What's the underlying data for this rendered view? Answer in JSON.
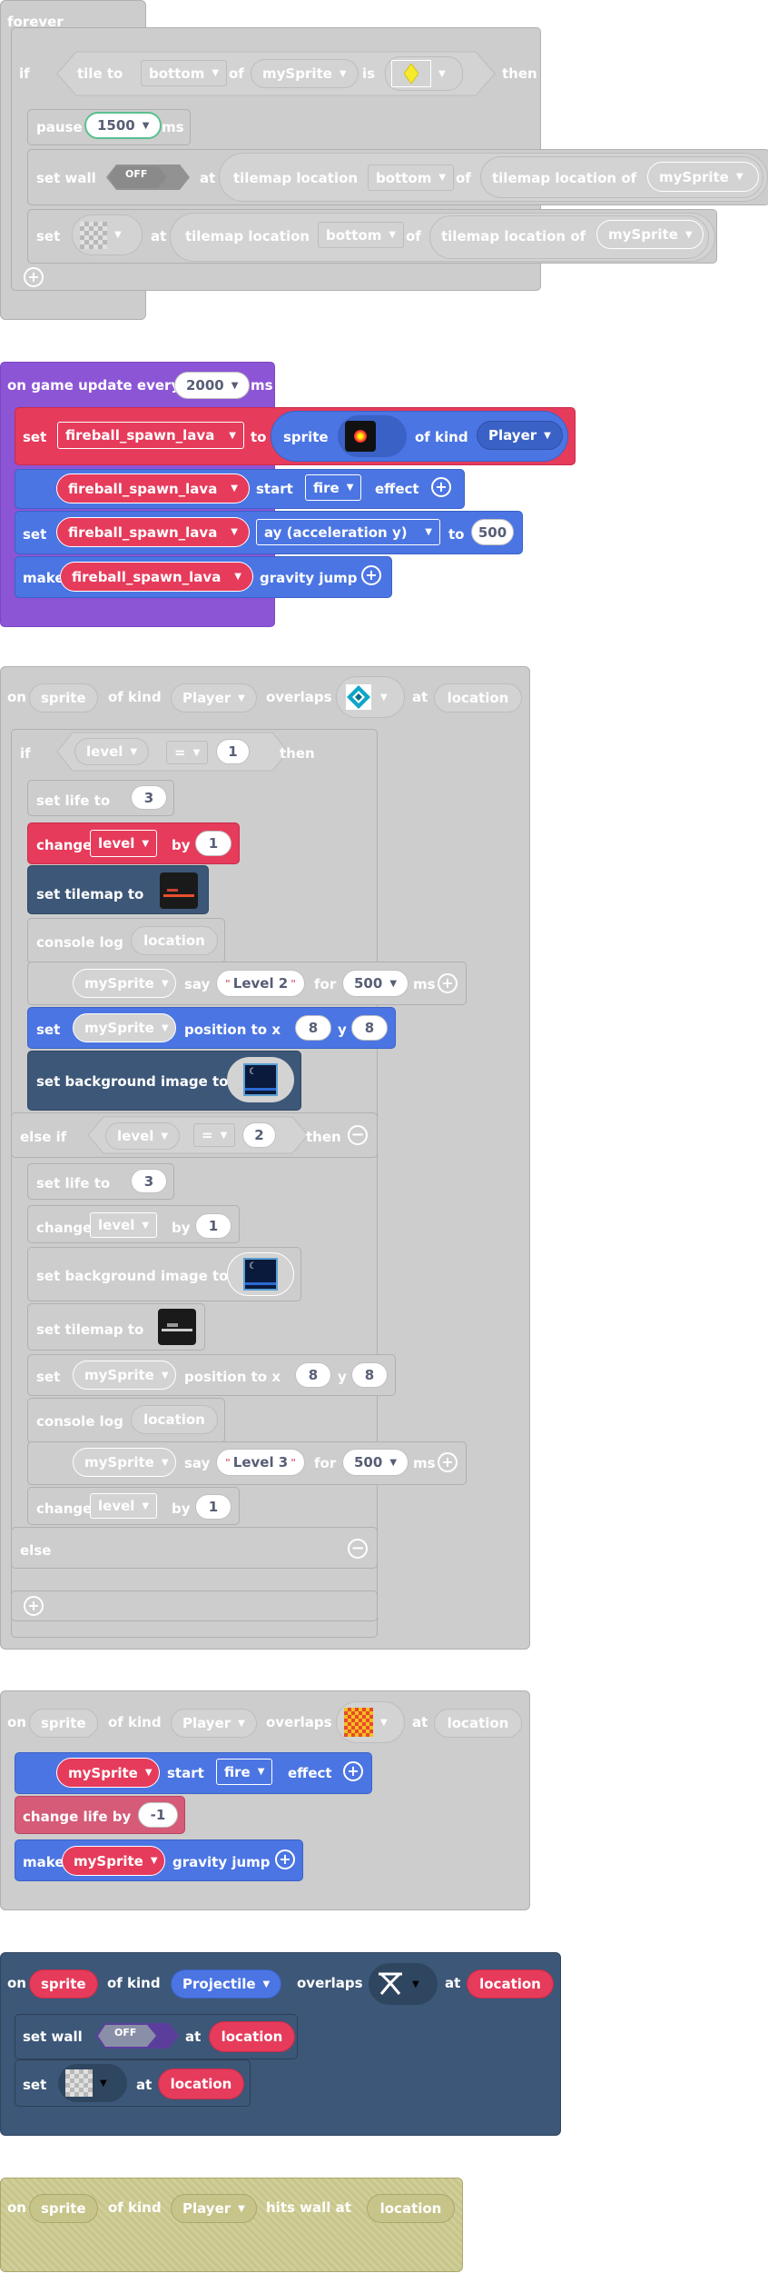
{
  "forever": {
    "hat": "forever",
    "if_label": "if",
    "tile_to": "tile to",
    "bottom": "bottom",
    "of": "of",
    "mySprite": "mySprite",
    "is": "is",
    "then": "then",
    "pause": "pause",
    "pause_value": "1500",
    "ms": "ms",
    "set_wall": "set wall",
    "off": "OFF",
    "at": "at",
    "tilemap_location": "tilemap location",
    "tilemap_location_of": "tilemap location of",
    "set": "set"
  },
  "game_update": {
    "hat": "on game update every",
    "interval": "2000",
    "ms": "ms",
    "set": "set",
    "var": "fireball_spawn_lava",
    "to": "to",
    "sprite": "sprite",
    "of_kind": "of kind",
    "kind": "Player",
    "start": "start",
    "effect_name": "fire",
    "effect": "effect",
    "ay": "ay (acceleration y)",
    "ay_value": "500",
    "make": "make",
    "gravity_jump": "gravity jump"
  },
  "overlap1": {
    "on": "on",
    "sprite": "sprite",
    "of_kind": "of kind",
    "kind": "Player",
    "overlaps": "overlaps",
    "at": "at",
    "location": "location",
    "if_label": "if",
    "level": "level",
    "eq": "=",
    "one": "1",
    "two": "2",
    "then": "then",
    "set_life_to": "set life to",
    "life": "3",
    "change": "change",
    "by": "by",
    "set_tilemap_to": "set tilemap to",
    "console_log": "console log",
    "mySprite": "mySprite",
    "say": "say",
    "say1": "Level 2",
    "say2": "Level 3",
    "for": "for",
    "dur": "500",
    "ms": "ms",
    "set": "set",
    "position_to_x": "position to x",
    "x": "8",
    "y_label": "y",
    "y": "8",
    "set_bg": "set background image to",
    "else_if": "else if",
    "else": "else"
  },
  "overlap2": {
    "on": "on",
    "sprite": "sprite",
    "of_kind": "of kind",
    "kind": "Player",
    "overlaps": "overlaps",
    "at": "at",
    "location": "location",
    "mySprite": "mySprite",
    "start": "start",
    "effect_name": "fire",
    "effect": "effect",
    "change_life_by": "change life by",
    "life_delta": "-1",
    "make": "make",
    "gravity_jump": "gravity jump"
  },
  "overlap3": {
    "on": "on",
    "sprite": "sprite",
    "of_kind": "of kind",
    "kind": "Projectile",
    "overlaps": "overlaps",
    "at": "at",
    "location": "location",
    "set_wall": "set wall",
    "off": "OFF",
    "set": "set"
  },
  "hits_wall": {
    "on": "on",
    "sprite": "sprite",
    "of_kind": "of kind",
    "kind": "Player",
    "hits_wall_at": "hits wall at",
    "location": "location"
  },
  "colors": {
    "gray": "#cdcdcd",
    "purple": "#8c55d6",
    "red": "#e63b5b",
    "blue": "#4b75e3",
    "dark_blue": "#3d5778",
    "pink": "#d55b78",
    "olive": "#d1cf98"
  }
}
